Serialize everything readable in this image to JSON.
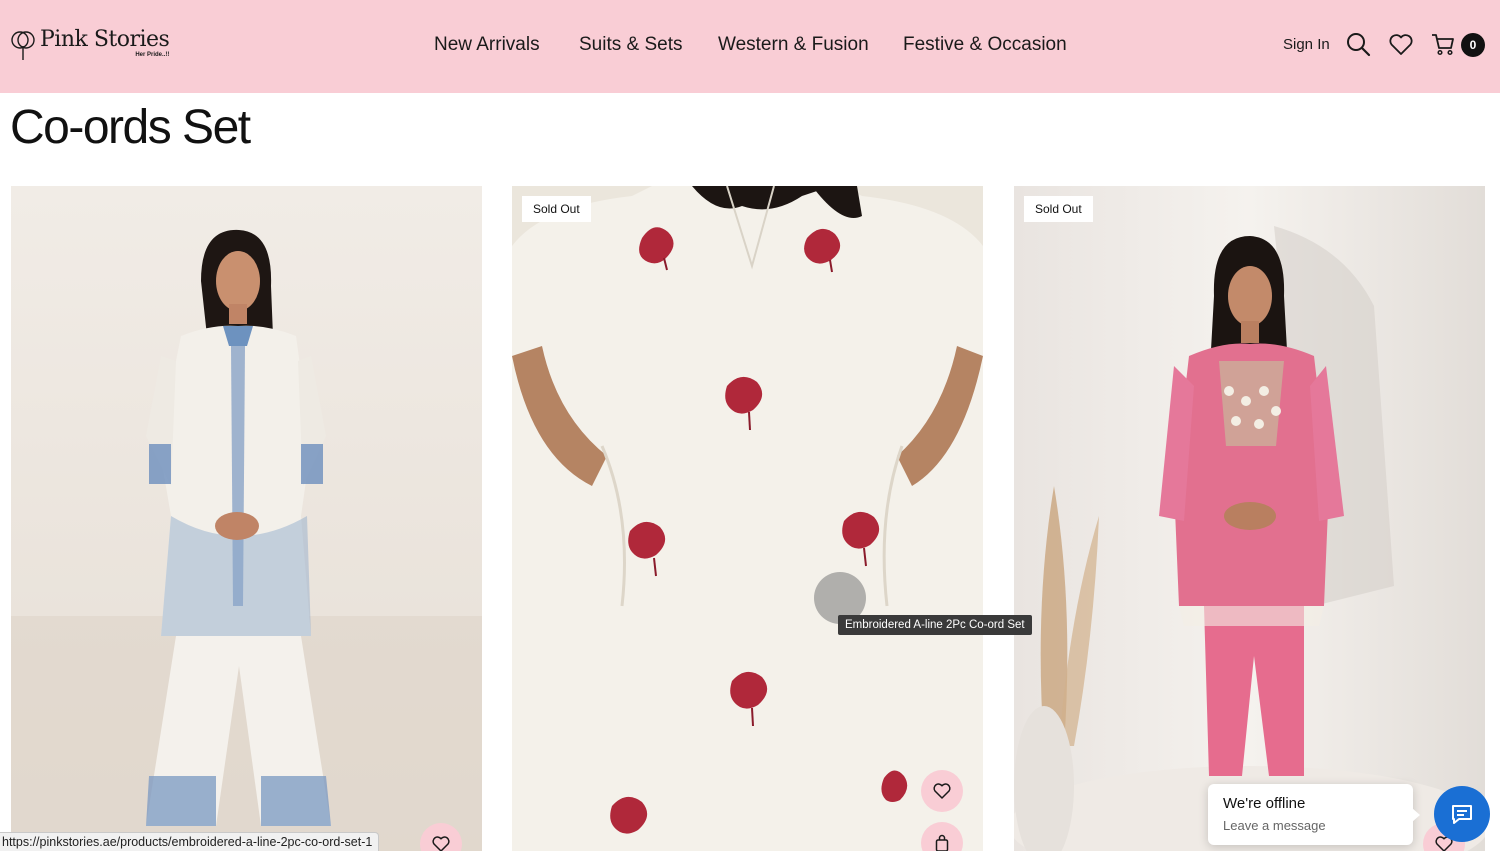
{
  "brand": {
    "name": "Pink Stories",
    "tagline": "Her Pride..!!"
  },
  "nav": {
    "items": [
      {
        "label": "New Arrivals"
      },
      {
        "label": "Suits & Sets"
      },
      {
        "label": "Western & Fusion"
      },
      {
        "label": "Festive & Occasion"
      }
    ]
  },
  "header_actions": {
    "sign_in": "Sign In",
    "search_icon": "search-icon",
    "wishlist_icon": "heart-icon",
    "cart_icon": "cart-icon",
    "cart_count": "0"
  },
  "page": {
    "title": "Co-ords Set"
  },
  "products": [
    {
      "badge": "",
      "image_desc": "white-blue-embroidered-coord"
    },
    {
      "badge": "Sold Out",
      "image_desc": "white-red-floral-aline-coord"
    },
    {
      "badge": "Sold Out",
      "image_desc": "pink-mirror-work-coord"
    }
  ],
  "tooltip": {
    "text": "Embroidered A-line 2Pc Co-ord Set"
  },
  "status_url": "https://pinkstories.ae/products/embroidered-a-line-2pc-co-ord-set-1",
  "chat": {
    "title": "We're offline",
    "subtitle": "Leave a message"
  },
  "colors": {
    "header_bg": "#f9cdd5",
    "chat_accent": "#1a6fd4",
    "action_bg": "#f9cdd5"
  }
}
